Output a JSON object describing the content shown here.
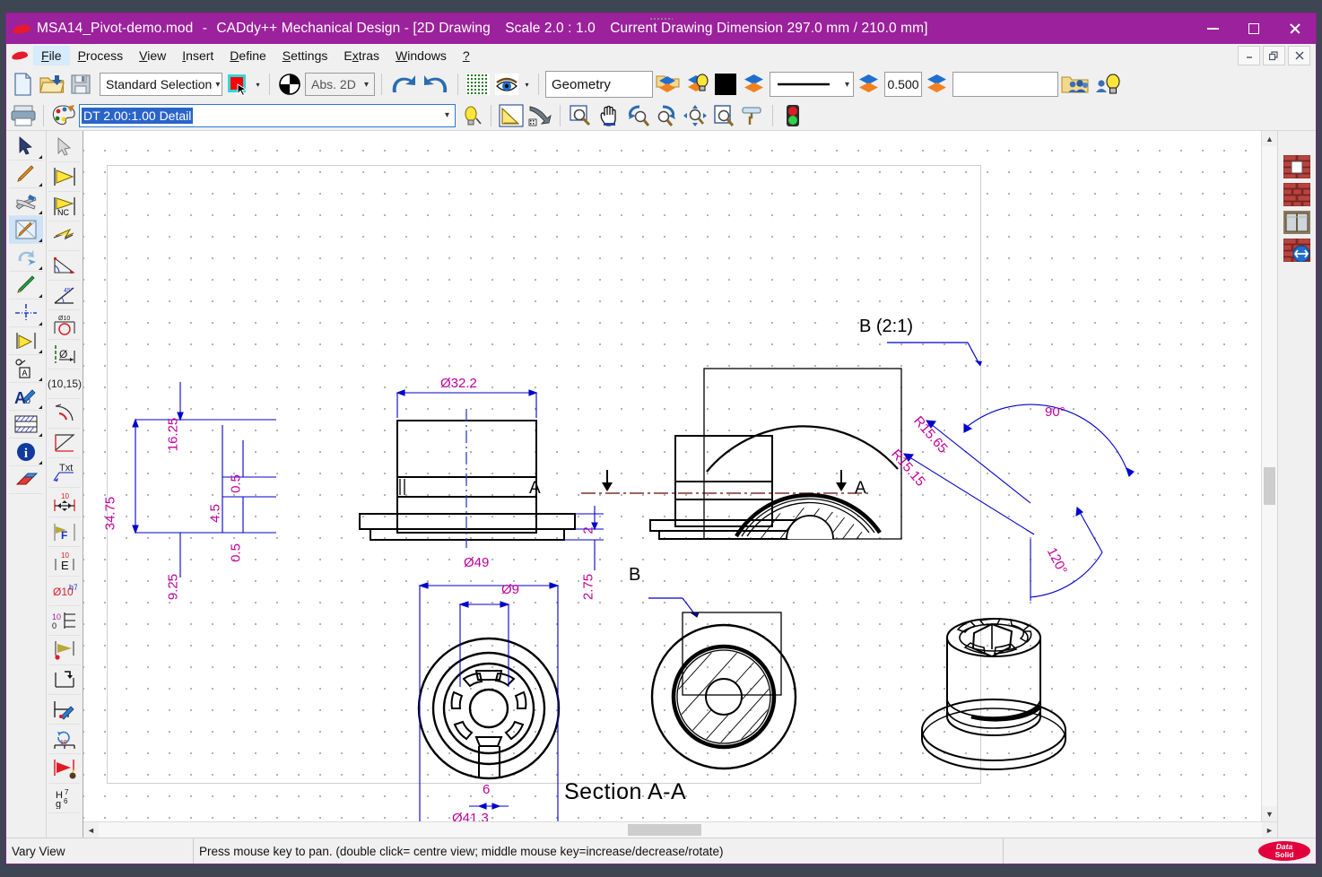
{
  "window": {
    "title_file": "MSA14_Pivot-demo.mod",
    "title_app": "CADdy++ Mechanical Design - [2D Drawing",
    "title_scale": "Scale 2.0 : 1.0",
    "title_dim": "Current Drawing Dimension 297.0 mm / 210.0 mm]",
    "minimize": "–",
    "maximize": "□",
    "close": "✕"
  },
  "menu": {
    "items": [
      {
        "label": "File",
        "accel": "F"
      },
      {
        "label": "Process",
        "accel": "P"
      },
      {
        "label": "View",
        "accel": "V"
      },
      {
        "label": "Insert",
        "accel": "I"
      },
      {
        "label": "Define",
        "accel": "D"
      },
      {
        "label": "Settings",
        "accel": "S"
      },
      {
        "label": "Extras",
        "accel": "x"
      },
      {
        "label": "Windows",
        "accel": "W"
      },
      {
        "label": "?",
        "accel": "?"
      }
    ],
    "mdi": {
      "minimize": "_",
      "restore": "❐",
      "close": "✕"
    }
  },
  "toolbar1": {
    "new": "new-file",
    "open": "open-file",
    "save": "save-file",
    "selection_mode": "Standard Selection",
    "color_swatch": "#ff0000",
    "coord_mode": "Abs. 2D",
    "undo": "undo",
    "redo": "redo",
    "grid": "grid-toggle",
    "eye": "visibility",
    "layer_name": "Geometry",
    "layer_color": "#000000",
    "line_width": "0.500",
    "extra_field": ""
  },
  "toolbar2": {
    "print": "print",
    "palette": "color-palette",
    "view_select": "DT 2.00:1.00 Detail",
    "bulb": "light",
    "triangle": "construction",
    "eagle": "snap",
    "zoom_window": "zoom-window",
    "pan": "pan-hand",
    "zoom_out": "zoom-out",
    "zoom_in": "zoom-in",
    "zoom_all": "zoom-all",
    "zoom_page": "zoom-page",
    "roller": "redraw",
    "traffic": "traffic-light"
  },
  "left_toolbar_a": [
    "arrow-select-tool",
    "pencil-draw-tool",
    "modify-tool",
    "trim-extend-tool",
    "transform-tool",
    "green-pencil-tool",
    "centerline-tool",
    "dimension-tool",
    "surface-finish-tool",
    "text-tool",
    "hatch-tool",
    "info-tool",
    "eraser-tool"
  ],
  "left_toolbar_b": [
    "pointer-grey-tool",
    "dimension-linear-tool",
    "dimension-nc-tool",
    "dimension-chain-tool",
    "angle-dimension-tool",
    "angle-tool",
    "diameter-circle-tool",
    "diameter-axis-tool",
    "coordinate-tool",
    "arc-dim-tool",
    "taper-tool",
    "text-leader-tool",
    "dim-move-tool",
    "dim-format-tool",
    "dim-edit-tool",
    "fit-tolerance-tool",
    "tolerance-tool",
    "dim-point-tool",
    "dim-step-tool",
    "dim-paint-tool",
    "dim-rotate-tool",
    "dim-delete-tool",
    "fit-hg-tool"
  ],
  "left_toolbar_b_text": {
    "coordinate": "(10,15)",
    "txt": "Txt",
    "ten_top": "10",
    "f_label": "F",
    "e_top": "10",
    "e_label": "E",
    "dia_label": "Ø10",
    "dia_sup": "h7",
    "step_top": "10",
    "step_bot": "0",
    "rot_num": "10",
    "fit_upper": "H",
    "fit_upper_sup": "7",
    "fit_lower": "g",
    "fit_lower_sup": "6"
  },
  "right_toolbar": [
    "wall-opening-icon",
    "wall-solid-icon",
    "window-icon",
    "wall-modify-icon"
  ],
  "drawing": {
    "front_view": {
      "d32_2": "Ø32.2",
      "d49": "Ø49",
      "d9": "Ø9",
      "d41_3": "Ø41.3",
      "six": "6",
      "h34_75": "34.75",
      "h16_25": "16.25",
      "h9_25": "9.25",
      "h4_5": "4.5",
      "h0_5a": "0.5",
      "h0_5b": "0.5",
      "h2": "2",
      "h2_75": "2.75"
    },
    "section_marks": {
      "a_left": "A",
      "a_right": "A",
      "b_mark": "B"
    },
    "detail_view": {
      "title": "B  (2:1)",
      "r15_65": "R15.65",
      "r15_15": "R15.15",
      "ang90": "90°",
      "ang120": "120°"
    },
    "section_title": "Section A-A",
    "colors": {
      "dimension_text": "#c2009b",
      "dimension_line": "#0000cc",
      "section_line": "#7b3030",
      "geometry": "#000000"
    }
  },
  "status": {
    "mode": "Vary View",
    "hint": "Press mouse key to pan. (double click= centre view; middle mouse key=increase/decrease/rotate)",
    "logo_top": "Data",
    "logo_bottom": "Solid"
  },
  "scrollbars": {
    "up": "▲",
    "down": "▼",
    "left": "‹",
    "right": "›"
  }
}
